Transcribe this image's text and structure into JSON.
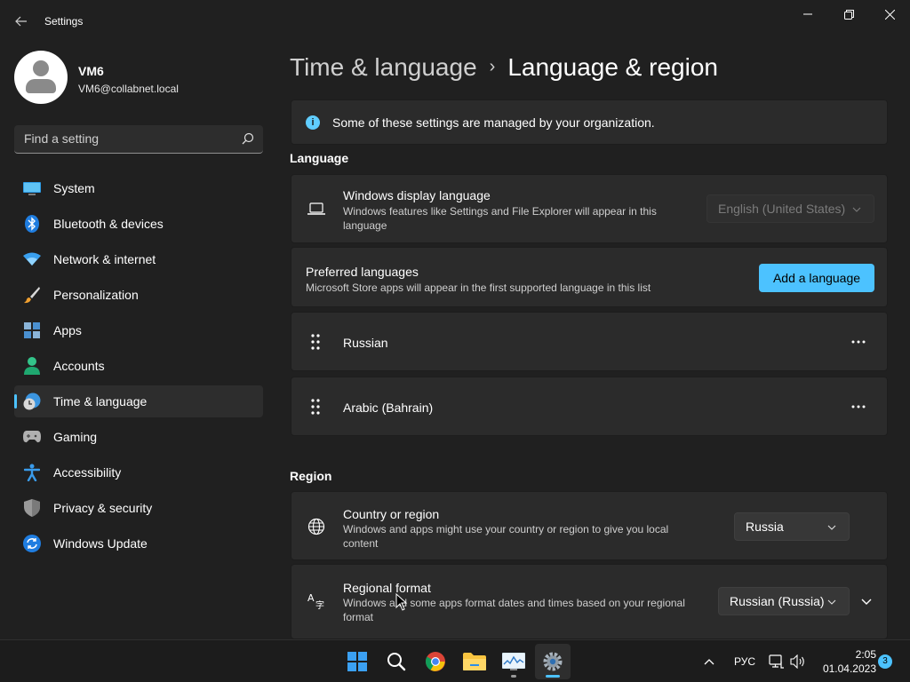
{
  "window": {
    "title": "Settings",
    "back_icon": "back-arrow-icon",
    "controls": [
      "minimize-icon",
      "restore-icon",
      "close-icon"
    ]
  },
  "profile": {
    "name": "VM6",
    "email": "VM6@collabnet.local"
  },
  "search": {
    "placeholder": "Find a setting"
  },
  "sidebar": {
    "items": [
      {
        "label": "System",
        "icon": "system-monitor-icon",
        "active": false
      },
      {
        "label": "Bluetooth & devices",
        "icon": "bluetooth-icon",
        "active": false
      },
      {
        "label": "Network & internet",
        "icon": "wifi-icon",
        "active": false
      },
      {
        "label": "Personalization",
        "icon": "brush-icon",
        "active": false
      },
      {
        "label": "Apps",
        "icon": "apps-grid-icon",
        "active": false
      },
      {
        "label": "Accounts",
        "icon": "person-icon",
        "active": false
      },
      {
        "label": "Time & language",
        "icon": "globe-clock-icon",
        "active": true
      },
      {
        "label": "Gaming",
        "icon": "gamepad-icon",
        "active": false
      },
      {
        "label": "Accessibility",
        "icon": "accessibility-icon",
        "active": false
      },
      {
        "label": "Privacy & security",
        "icon": "shield-icon",
        "active": false
      },
      {
        "label": "Windows Update",
        "icon": "update-icon",
        "active": false
      }
    ]
  },
  "breadcrumb": {
    "parent": "Time & language",
    "separator": "›",
    "current": "Language & region"
  },
  "info_bar": {
    "text": "Some of these settings are managed by your organization."
  },
  "language_section": {
    "header": "Language",
    "display_language": {
      "title": "Windows display language",
      "description": "Windows features like Settings and File Explorer will appear in this language",
      "value": "English (United States)"
    },
    "preferred": {
      "title": "Preferred languages",
      "description": "Microsoft Store apps will appear in the first supported language in this list",
      "add_button": "Add a language"
    },
    "languages": [
      {
        "name": "Russian"
      },
      {
        "name": "Arabic (Bahrain)"
      }
    ]
  },
  "region_section": {
    "header": "Region",
    "country": {
      "title": "Country or region",
      "description": "Windows and apps might use your country or region to give you local content",
      "value": "Russia"
    },
    "format": {
      "title": "Regional format",
      "description": "Windows and some apps format dates and times based on your regional format",
      "value": "Russian (Russia)"
    }
  },
  "taskbar": {
    "apps": [
      "windows-start-icon",
      "search-icon",
      "chrome-icon",
      "file-explorer-icon",
      "performance-monitor-icon",
      "settings-gear-icon"
    ],
    "tray_language": "РУС",
    "time": "2:05",
    "date": "01.04.2023",
    "notification_count": "3"
  },
  "colors": {
    "accent": "#4cc2ff",
    "background": "#202020",
    "card": "#2b2b2b"
  }
}
